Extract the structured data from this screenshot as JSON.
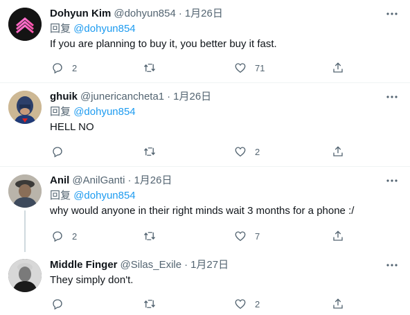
{
  "reply_prefix": "回复",
  "tweets": [
    {
      "name": "Dohyun Kim",
      "handle": "@dohyun854",
      "date": "1月26日",
      "reply_to": "@dohyun854",
      "text": "If you are planning to buy it, you better buy it fast.",
      "reply_count": "2",
      "retweet_count": "",
      "like_count": "71"
    },
    {
      "name": "ghuik",
      "handle": "@junericancheta1",
      "date": "1月26日",
      "reply_to": "@dohyun854",
      "text": "HELL NO",
      "reply_count": "",
      "retweet_count": "",
      "like_count": "2"
    },
    {
      "name": "Anil",
      "handle": "@AnilGanti",
      "date": "1月26日",
      "reply_to": "@dohyun854",
      "text": "why would anyone in their right minds wait 3 months for a phone :/",
      "reply_count": "2",
      "retweet_count": "",
      "like_count": "7"
    },
    {
      "name": "Middle Finger",
      "handle": "@Silas_Exile",
      "date": "1月27日",
      "reply_to": "",
      "text": "They simply don't.",
      "reply_count": "",
      "retweet_count": "",
      "like_count": "2"
    }
  ],
  "separator": "·",
  "colors": {
    "text": "#0f1419",
    "secondary": "#536471",
    "link": "#1d9bf0",
    "divider": "#eff3f4",
    "thread_line": "#cfd9de"
  }
}
